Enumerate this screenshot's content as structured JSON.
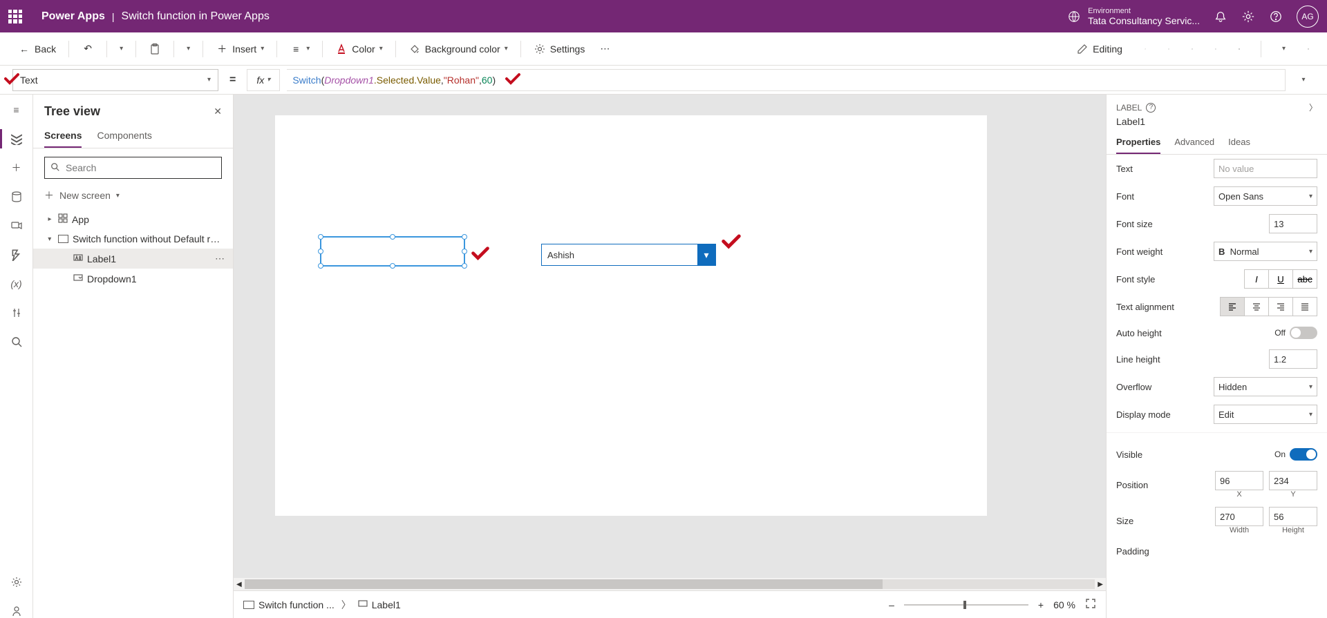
{
  "header": {
    "app_name": "Power Apps",
    "separator": "|",
    "doc_name": "Switch function in Power Apps",
    "env_label": "Environment",
    "env_name": "Tata Consultancy Servic...",
    "avatar_initials": "AG"
  },
  "command_bar": {
    "back": "Back",
    "insert": "Insert",
    "color": "Color",
    "bg_color": "Background color",
    "settings": "Settings",
    "editing": "Editing"
  },
  "formula": {
    "property": "Text",
    "fx_label": "fx",
    "tokens": {
      "func": "Switch",
      "paren_open": "(",
      "ident": "Dropdown1",
      "prop": ".Selected.Value",
      "comma1": ",",
      "str": "\"Rohan\"",
      "comma2": ", ",
      "num": "60",
      "paren_close": ")"
    }
  },
  "tree": {
    "title": "Tree view",
    "tabs": {
      "screens": "Screens",
      "components": "Components"
    },
    "search_placeholder": "Search",
    "new_screen": "New screen",
    "items": {
      "app": "App",
      "screen": "Switch function without Default result",
      "label": "Label1",
      "dropdown": "Dropdown1"
    }
  },
  "canvas": {
    "dropdown_value": "Ashish"
  },
  "status": {
    "crumb_screen": "Switch function ...",
    "crumb_label": "Label1",
    "zoom": "60  %"
  },
  "props": {
    "type": "LABEL",
    "name": "Label1",
    "tabs": {
      "properties": "Properties",
      "advanced": "Advanced",
      "ideas": "Ideas"
    },
    "rows": {
      "text": "Text",
      "text_val": "No value",
      "font": "Font",
      "font_val": "Open Sans",
      "font_size": "Font size",
      "font_size_val": "13",
      "font_weight": "Font weight",
      "font_weight_val": "Normal",
      "font_style": "Font style",
      "text_align": "Text alignment",
      "auto_height": "Auto height",
      "auto_height_state": "Off",
      "line_height": "Line height",
      "line_height_val": "1.2",
      "overflow": "Overflow",
      "overflow_val": "Hidden",
      "display_mode": "Display mode",
      "display_mode_val": "Edit",
      "visible": "Visible",
      "visible_state": "On",
      "position": "Position",
      "pos_x": "96",
      "pos_y": "234",
      "pos_x_lbl": "X",
      "pos_y_lbl": "Y",
      "size": "Size",
      "size_w": "270",
      "size_h": "56",
      "size_w_lbl": "Width",
      "size_h_lbl": "Height",
      "padding": "Padding"
    }
  }
}
